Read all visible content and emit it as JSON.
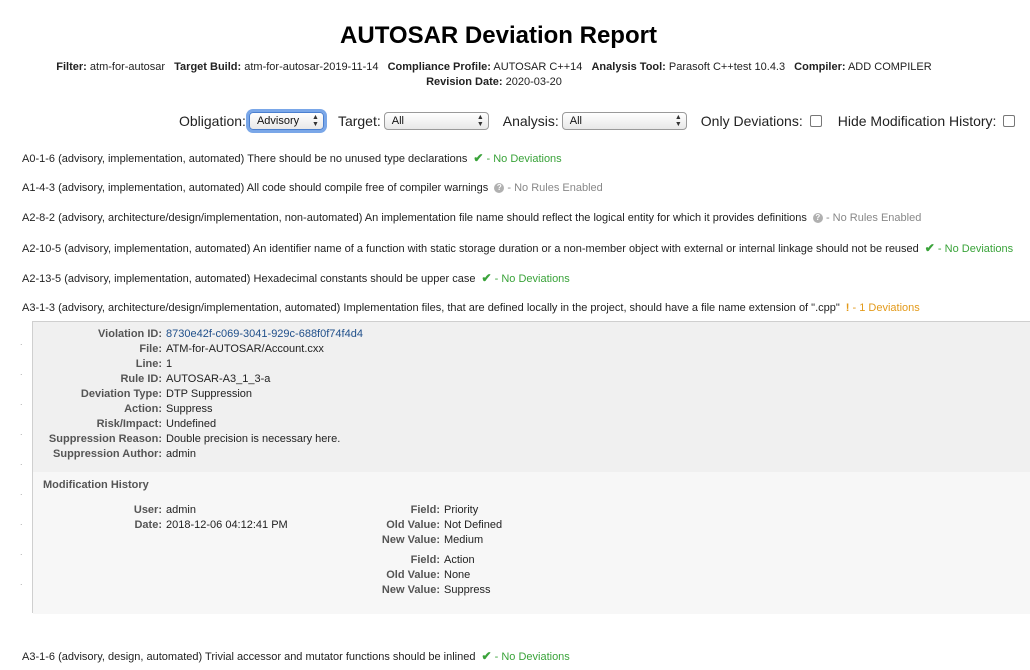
{
  "report": {
    "title": "AUTOSAR Deviation Report",
    "meta": {
      "filter_label": "Filter:",
      "filter": "atm-for-autosar",
      "build_label": "Target Build:",
      "build": "atm-for-autosar-2019-11-14",
      "profile_label": "Compliance Profile:",
      "profile": "AUTOSAR C++14",
      "tool_label": "Analysis Tool:",
      "tool": "Parasoft C++test 10.4.3",
      "compiler_label": "Compiler:",
      "compiler": "ADD COMPILER",
      "revision_label": "Revision Date:",
      "revision": "2020-03-20"
    }
  },
  "filters": {
    "obligation_label": "Obligation:",
    "obligation_value": "Advisory",
    "target_label": "Target:",
    "target_value": "All",
    "analysis_label": "Analysis:",
    "analysis_value": "All",
    "only_deviations_label": "Only Deviations:",
    "hide_history_label": "Hide Modification History:"
  },
  "rules": [
    {
      "text": "A0-1-6 (advisory, implementation, automated) There should be no unused type declarations",
      "status": "- No Deviations",
      "kind": "ok"
    },
    {
      "text": "A1-4-3 (advisory, implementation, automated) All code should compile free of compiler warnings",
      "status": "- No Rules Enabled",
      "kind": "none"
    },
    {
      "text": "A2-8-2 (advisory, architecture/design/implementation, non-automated) An implementation file name should reflect the logical entity for which it provides definitions",
      "status": "- No Rules Enabled",
      "kind": "none"
    },
    {
      "text": "A2-10-5 (advisory, implementation, automated) An identifier name of a function with static storage duration or a non-member object with external or internal linkage should not be reused",
      "status": "- No Deviations",
      "kind": "ok"
    },
    {
      "text": "A2-13-5 (advisory, implementation, automated) Hexadecimal constants should be upper case",
      "status": "- No Deviations",
      "kind": "ok"
    },
    {
      "text": "A3-1-3 (advisory, architecture/design/implementation, automated) Implementation files, that are defined locally in the project, should have a file name extension of \".cpp\"",
      "status": "- 1 Deviations",
      "kind": "warn"
    },
    {
      "text": "A3-1-6 (advisory, design, automated) Trivial accessor and mutator functions should be inlined",
      "status": "- No Deviations",
      "kind": "ok"
    }
  ],
  "violation": {
    "id_label": "Violation ID:",
    "id": "8730e42f-c069-3041-929c-688f0f74f4d4",
    "file_label": "File:",
    "file": "ATM-for-AUTOSAR/Account.cxx",
    "line_label": "Line:",
    "line": "1",
    "rule_label": "Rule ID:",
    "rule": "AUTOSAR-A3_1_3-a",
    "type_label": "Deviation Type:",
    "type": "DTP Suppression",
    "action_label": "Action:",
    "action": "Suppress",
    "risk_label": "Risk/Impact:",
    "risk": "Undefined",
    "reason_label": "Suppression Reason:",
    "reason": "Double precision is necessary here.",
    "author_label": "Suppression Author:",
    "author": "admin"
  },
  "history": {
    "title": "Modification History",
    "user_label": "User:",
    "user": "admin",
    "date_label": "Date:",
    "date": "2018-12-06 04:12:41 PM",
    "changes": [
      {
        "field_label": "Field:",
        "field": "Priority",
        "old_label": "Old Value:",
        "old": "Not Defined",
        "new_label": "New Value:",
        "new": "Medium"
      },
      {
        "field_label": "Field:",
        "field": "Action",
        "old_label": "Old Value:",
        "old": "None",
        "new_label": "New Value:",
        "new": "Suppress"
      }
    ]
  }
}
